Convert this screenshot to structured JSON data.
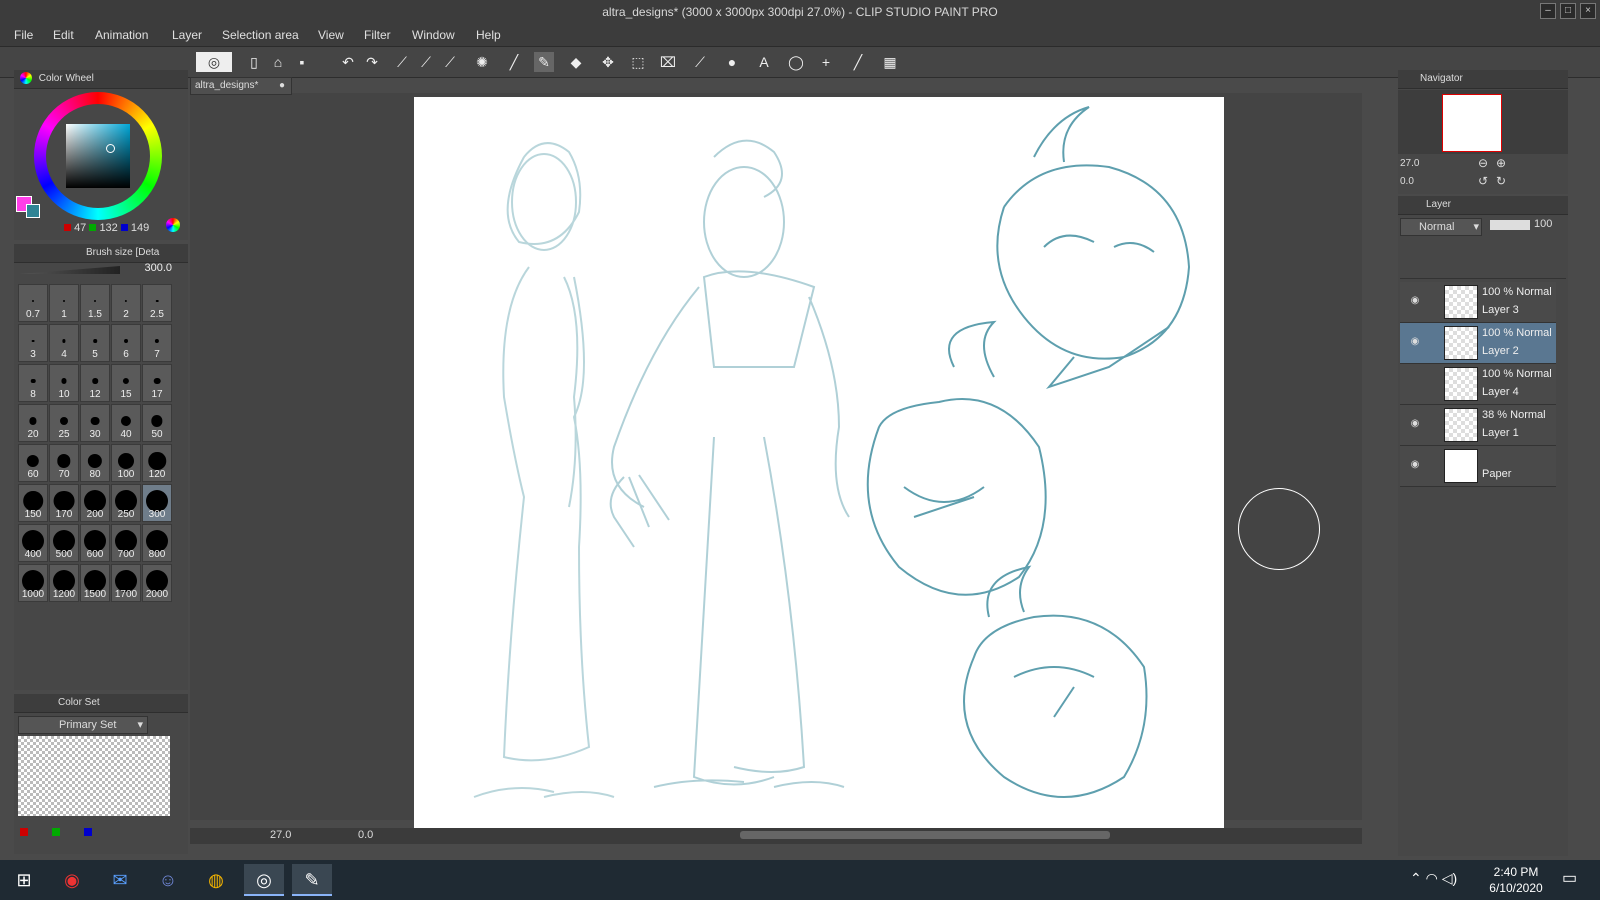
{
  "window": {
    "title": "altra_designs* (3000 x 3000px 300dpi 27.0%) - CLIP STUDIO PAINT PRO"
  },
  "menu": [
    "File",
    "Edit",
    "Animation",
    "Layer",
    "Selection area",
    "View",
    "Filter",
    "Window",
    "Help"
  ],
  "color_wheel": {
    "tab_label": "Color Wheel",
    "r": "47",
    "g": "132",
    "b": "149",
    "main_color": "#2f8495",
    "sub_color": "#ff3ee8"
  },
  "brush_size": {
    "tab_label": "Brush size [Deta",
    "value": "300.0",
    "sizes": [
      "0.7",
      "1",
      "1.5",
      "2",
      "2.5",
      "3",
      "4",
      "5",
      "6",
      "7",
      "8",
      "10",
      "12",
      "15",
      "17",
      "20",
      "25",
      "30",
      "40",
      "50",
      "60",
      "70",
      "80",
      "100",
      "120",
      "150",
      "170",
      "200",
      "250",
      "300",
      "400",
      "500",
      "600",
      "700",
      "800",
      "1000",
      "1200",
      "1500",
      "1700",
      "2000"
    ],
    "selected": "300"
  },
  "color_set": {
    "tab_label": "Color Set",
    "set_name": "Primary Set"
  },
  "document_tab": "altra_designs*",
  "status": {
    "zoom": "27.0",
    "rotation": "0.0"
  },
  "navigator": {
    "tab_label": "Navigator",
    "zoom": "27.0",
    "rotation": "0.0"
  },
  "layer_panel": {
    "tab_label": "Layer",
    "blend_mode": "Normal",
    "opacity": "100",
    "layers": [
      {
        "mode": "100 % Normal",
        "name": "Layer 3",
        "visible": true,
        "selected": false
      },
      {
        "mode": "100 % Normal",
        "name": "Layer 2",
        "visible": true,
        "selected": true
      },
      {
        "mode": "100 % Normal",
        "name": "Layer 4",
        "visible": false,
        "selected": false
      },
      {
        "mode": "38 % Normal",
        "name": "Layer 1",
        "visible": true,
        "selected": false
      },
      {
        "mode": "",
        "name": "Paper",
        "visible": true,
        "selected": false
      }
    ]
  },
  "taskbar": {
    "time": "2:40 PM",
    "date": "6/10/2020",
    "apps": [
      "start-icon",
      "app-icon",
      "mail-icon",
      "discord-icon",
      "chrome-icon",
      "clip-studio-icon",
      "clip-studio-paint-icon"
    ]
  }
}
